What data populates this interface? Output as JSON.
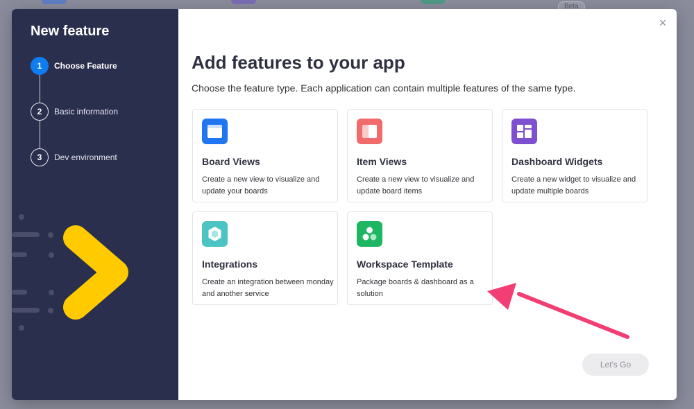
{
  "background": {
    "beta_badge": "Beta"
  },
  "modal": {
    "sidebar": {
      "title": "New feature",
      "steps": [
        {
          "number": "1",
          "label": "Choose Feature",
          "active": true
        },
        {
          "number": "2",
          "label": "Basic information",
          "active": false
        },
        {
          "number": "3",
          "label": "Dev environment",
          "active": false
        }
      ]
    },
    "main": {
      "close_icon": "×",
      "heading": "Add features to your app",
      "subheading": "Choose the feature type. Each application can contain multiple features of the same type.",
      "features": [
        {
          "title": "Board Views",
          "description": "Create a new view to visualize and update your boards",
          "icon": "board-view-icon",
          "color": "#1f76f0"
        },
        {
          "title": "Item Views",
          "description": "Create a new view to visualize and update board items",
          "icon": "item-view-icon",
          "color": "#f26b6b"
        },
        {
          "title": "Dashboard Widgets",
          "description": "Create a new widget to visualize and update multiple boards",
          "icon": "dashboard-widget-icon",
          "color": "#7e4fd0"
        },
        {
          "title": "Integrations",
          "description": "Create an integration between monday and another service",
          "icon": "integration-icon",
          "color": "#4cc4c4"
        },
        {
          "title": "Workspace Template",
          "description": "Package boards & dashboard as a solution",
          "icon": "workspace-template-icon",
          "color": "#1fb663"
        }
      ],
      "primary_button": "Let's Go"
    }
  },
  "colors": {
    "sidebar_bg": "#2b2f4e",
    "active_step": "#0f7cf0",
    "annotation_arrow": "#f23e72",
    "brand_chevron": "#ffcb00"
  }
}
